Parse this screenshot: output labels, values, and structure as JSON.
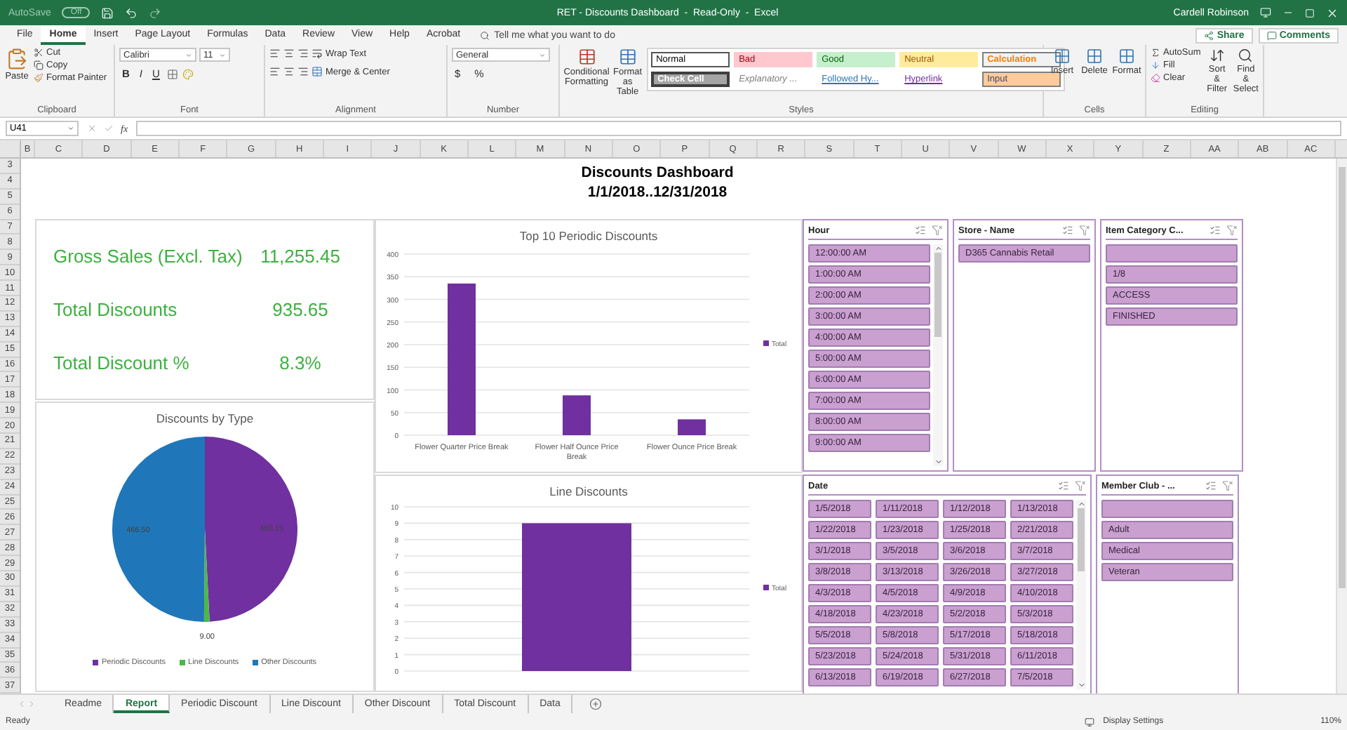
{
  "title_bar": {
    "autosave": "AutoSave",
    "autosave_state": "Off",
    "autosave_on": false,
    "title": "RET - Discounts Dashboard  -  Read-Only  -  Excel",
    "user": "Cardell Robinson"
  },
  "menu_tabs": [
    {
      "label": "File",
      "selected": false
    },
    {
      "label": "Home",
      "selected": true
    },
    {
      "label": "Insert",
      "selected": false
    },
    {
      "label": "Page Layout",
      "selected": false
    },
    {
      "label": "Formulas",
      "selected": false
    },
    {
      "label": "Data",
      "selected": false
    },
    {
      "label": "Review",
      "selected": false
    },
    {
      "label": "View",
      "selected": false
    },
    {
      "label": "Help",
      "selected": false
    },
    {
      "label": "Acrobat",
      "selected": false
    }
  ],
  "tell_me": {
    "placeholder": "Tell me what you want to do"
  },
  "share": "Share",
  "comments": "Comments",
  "clipboard": {
    "label": "Clipboard",
    "paste": "Paste",
    "cut": "Cut",
    "copy": "Copy",
    "format_painter": "Format Painter"
  },
  "font": {
    "label": "Font",
    "name": "Calibri",
    "size": "11",
    "bold": "B",
    "italic": "I",
    "underline": "U"
  },
  "alignment": {
    "label": "Alignment",
    "wrap": "Wrap Text",
    "merge": "Merge & Center"
  },
  "number": {
    "label": "Number",
    "format": "General",
    "currency": "$",
    "percent": "%"
  },
  "styles": {
    "label": "Styles",
    "conditional": "Conditional Formatting",
    "format_table": "Format as Table",
    "cell_styles": [
      {
        "label": "Normal",
        "kind": "normal"
      },
      {
        "label": "Bad",
        "kind": "bad"
      },
      {
        "label": "Good",
        "kind": "good"
      },
      {
        "label": "Neutral",
        "kind": "neutral"
      },
      {
        "label": "Calculation",
        "kind": "calculation"
      },
      {
        "label": "Check Cell",
        "kind": "check"
      },
      {
        "label": "Explanatory ...",
        "kind": "explanatory"
      },
      {
        "label": "Followed Hy...",
        "kind": "followed"
      },
      {
        "label": "Hyperlink",
        "kind": "hyperlink"
      },
      {
        "label": "Input",
        "kind": "input"
      }
    ]
  },
  "cells": {
    "label": "Cells",
    "buttons": [
      "Insert",
      "Delete",
      "Format"
    ]
  },
  "editing": {
    "label": "Editing",
    "autosum": "AutoSum",
    "fill": "Fill",
    "clear": "Clear",
    "sort": "Sort & Filter",
    "find": "Find & Select"
  },
  "formula_bar": {
    "name_box": "U41",
    "fx": "fx"
  },
  "columns": [
    "B",
    "C",
    "D",
    "E",
    "F",
    "G",
    "H",
    "I",
    "J",
    "K",
    "L",
    "M",
    "N",
    "O",
    "P",
    "Q",
    "R",
    "S",
    "T",
    "U",
    "V",
    "W",
    "X",
    "Y",
    "Z",
    "AA",
    "AB",
    "AC"
  ],
  "rows": [
    "3",
    "4",
    "5",
    "6",
    "7",
    "8",
    "9",
    "10",
    "11",
    "12",
    "13",
    "14",
    "15",
    "16",
    "17",
    "18",
    "19",
    "20",
    "21",
    "22",
    "23",
    "24",
    "25",
    "26",
    "27",
    "28",
    "29",
    "30",
    "31",
    "32",
    "33",
    "34",
    "35",
    "36",
    "37"
  ],
  "dashboard": {
    "title": "Discounts Dashboard",
    "period": "1/1/2018..12/31/2018",
    "kpis": [
      {
        "label": "Gross Sales (Excl. Tax)",
        "value": "11,255.45"
      },
      {
        "label": "Total Discounts",
        "value": "935.65"
      },
      {
        "label": "Total Discount %",
        "value": "8.3%"
      }
    ],
    "pie": {
      "chart_data": {
        "type": "pie",
        "title": "Discounts by Type",
        "categories": [
          "Periodic Discounts",
          "Line Discounts",
          "Other Discounts"
        ],
        "values": [
          460.15,
          9,
          466.5
        ],
        "colors": [
          "#7030a0",
          "#4cb848",
          "#1f77b9"
        ],
        "value_labels": [
          "460.15",
          "9.00",
          "466.50"
        ],
        "legend": "bottom"
      }
    },
    "bar": {
      "chart_data": {
        "type": "bar",
        "title": "Top 10 Periodic Discounts",
        "categories": [
          "Flower Quarter Price Break",
          "Flower Half Ounce Price Break",
          "Flower Ounce Price Break"
        ],
        "series": [
          {
            "name": "Total",
            "color": "#7030a0",
            "values": [
              335,
              88,
              35
            ]
          }
        ],
        "ylim": [
          0,
          400
        ],
        "yticks": [
          0,
          50,
          100,
          150,
          200,
          250,
          300,
          350,
          400
        ],
        "grid": true,
        "legend": "right"
      }
    },
    "line": {
      "chart_data": {
        "type": "bar",
        "title": "Line Discounts",
        "series": [
          {
            "name": "Total",
            "color": "#7030a0",
            "values": [
              9
            ]
          }
        ],
        "ylim": [
          0,
          10
        ],
        "yticks": [
          0,
          1,
          2,
          3,
          4,
          5,
          6,
          7,
          8,
          9,
          10
        ],
        "grid": true,
        "legend": "right"
      }
    },
    "slicers_top": [
      {
        "title": "Hour",
        "scroll": true,
        "items": [
          {
            "label": "12:00:00 AM",
            "selected": true
          },
          {
            "label": "1:00:00 AM",
            "selected": true
          },
          {
            "label": "2:00:00 AM",
            "selected": true
          },
          {
            "label": "3:00:00 AM",
            "selected": true
          },
          {
            "label": "4:00:00 AM",
            "selected": true
          },
          {
            "label": "5:00:00 AM",
            "selected": true
          },
          {
            "label": "6:00:00 AM",
            "selected": true
          },
          {
            "label": "7:00:00 AM",
            "selected": true
          },
          {
            "label": "8:00:00 AM",
            "selected": true
          },
          {
            "label": "9:00:00 AM",
            "selected": true
          }
        ]
      },
      {
        "title": "Store - Name",
        "scroll": false,
        "items": [
          {
            "label": "D365 Cannabis Retail",
            "selected": true
          }
        ]
      },
      {
        "title": "Item Category C...",
        "scroll": false,
        "items": [
          {
            "selected": true
          },
          {
            "label": "1/8",
            "selected": true
          },
          {
            "label": "ACCESS",
            "selected": true
          },
          {
            "label": "FINISHED",
            "selected": true
          }
        ]
      }
    ],
    "date_slicer": {
      "title": "Date",
      "scroll": true,
      "items": [
        {
          "label": "1/5/2018",
          "selected": true
        },
        {
          "label": "1/11/2018",
          "selected": true
        },
        {
          "label": "1/12/2018",
          "selected": true
        },
        {
          "label": "1/13/2018",
          "selected": true
        },
        {
          "label": "1/22/2018",
          "selected": true
        },
        {
          "label": "1/23/2018",
          "selected": true
        },
        {
          "label": "1/25/2018",
          "selected": true
        },
        {
          "label": "2/21/2018",
          "selected": true
        },
        {
          "label": "3/1/2018",
          "selected": true
        },
        {
          "label": "3/5/2018",
          "selected": true
        },
        {
          "label": "3/6/2018",
          "selected": true
        },
        {
          "label": "3/7/2018",
          "selected": true
        },
        {
          "label": "3/8/2018",
          "selected": true
        },
        {
          "label": "3/13/2018",
          "selected": true
        },
        {
          "label": "3/26/2018",
          "selected": true
        },
        {
          "label": "3/27/2018",
          "selected": true
        },
        {
          "label": "4/3/2018",
          "selected": true
        },
        {
          "label": "4/5/2018",
          "selected": true
        },
        {
          "label": "4/9/2018",
          "selected": true
        },
        {
          "label": "4/10/2018",
          "selected": true
        },
        {
          "label": "4/18/2018",
          "selected": true
        },
        {
          "label": "4/23/2018",
          "selected": true
        },
        {
          "label": "5/2/2018",
          "selected": true
        },
        {
          "label": "5/3/2018",
          "selected": true
        },
        {
          "label": "5/5/2018",
          "selected": true
        },
        {
          "label": "5/8/2018",
          "selected": true
        },
        {
          "label": "5/17/2018",
          "selected": true
        },
        {
          "label": "5/18/2018",
          "selected": true
        },
        {
          "label": "5/23/2018",
          "selected": true
        },
        {
          "label": "5/24/2018",
          "selected": true
        },
        {
          "label": "5/31/2018",
          "selected": true
        },
        {
          "label": "6/11/2018",
          "selected": true
        },
        {
          "label": "6/13/2018",
          "selected": true
        },
        {
          "label": "6/19/2018",
          "selected": true
        },
        {
          "label": "6/27/2018",
          "selected": true
        },
        {
          "label": "7/5/2018",
          "selected": true
        }
      ]
    },
    "member_slicer": {
      "title": "Member Club - ...",
      "scroll": false,
      "items": [
        {
          "selected": true
        },
        {
          "label": "Adult",
          "selected": true
        },
        {
          "label": "Medical",
          "selected": true
        },
        {
          "label": "Veteran",
          "selected": true
        }
      ]
    }
  },
  "sheet_tabs": [
    {
      "label": "Readme",
      "selected": false
    },
    {
      "label": "Report",
      "selected": true
    },
    {
      "label": "Periodic Discount",
      "selected": false
    },
    {
      "label": "Line Discount",
      "selected": false
    },
    {
      "label": "Other Discount",
      "selected": false
    },
    {
      "label": "Total Discount",
      "selected": false
    },
    {
      "label": "Data",
      "selected": false
    }
  ],
  "status_bar": {
    "ready": "Ready",
    "display_settings": "Display Settings",
    "zoom": "110%"
  }
}
